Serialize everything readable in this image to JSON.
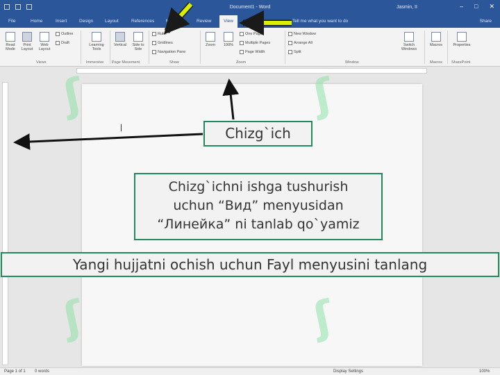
{
  "window": {
    "title": "Document1 - Word",
    "user": "Jasmin, II",
    "controls": [
      "–",
      "□",
      "✕"
    ]
  },
  "tabs": [
    {
      "label": "File"
    },
    {
      "label": "Home"
    },
    {
      "label": "Insert"
    },
    {
      "label": "Design"
    },
    {
      "label": "Layout"
    },
    {
      "label": "References"
    },
    {
      "label": "Mailings"
    },
    {
      "label": "Review"
    },
    {
      "label": "View",
      "active": true
    }
  ],
  "tell_me": "Tell me what you want to do",
  "share": "Share",
  "ribbon": {
    "views": {
      "read_mode": "Read Mode",
      "print_layout": "Print Layout",
      "web_layout": "Web Layout",
      "outline": "Outline",
      "draft": "Draft",
      "group": "Views"
    },
    "immersive": {
      "learning_tools": "Learning Tools",
      "group": "Immersive"
    },
    "page_movement": {
      "vertical": "Vertical",
      "side_to_side": "Side to Side",
      "group": "Page Movement"
    },
    "show": {
      "ruler": "Ruler",
      "gridlines": "Gridlines",
      "navigation_pane": "Navigation Pane",
      "group": "Show"
    },
    "zoom": {
      "zoom": "Zoom",
      "hundred": "100%",
      "one_page": "One Page",
      "multiple_pages": "Multiple Pages",
      "page_width": "Page Width",
      "group": "Zoom"
    },
    "window": {
      "new_window": "New Window",
      "arrange_all": "Arrange All",
      "split": "Split",
      "switch_windows": "Switch Windows",
      "group": "Window"
    },
    "macros": {
      "label": "Macros",
      "group": "Macros"
    },
    "sharepoint": {
      "properties": "Properties",
      "group": "SharePoint"
    }
  },
  "status": {
    "page": "Page 1 of 1",
    "words": "0 words",
    "display_settings": "Display Settings",
    "zoom": "100%"
  },
  "callouts": {
    "ruler": "Chizg`ich",
    "instruction_lines": [
      "Chizg`ichni ishga tushurish",
      "uchun “Вид” menyusidan",
      "“Линейка” ni tanlab qo`yamiz"
    ],
    "banner": "Yangi hujjatni ochish uchun Fayl menyusini tanlang"
  },
  "colors": {
    "title_bar": "#2b579a",
    "callout_border": "#1f8a5b",
    "arrow_highlight": "#d8f000",
    "watermark": "#8fe3a8"
  }
}
